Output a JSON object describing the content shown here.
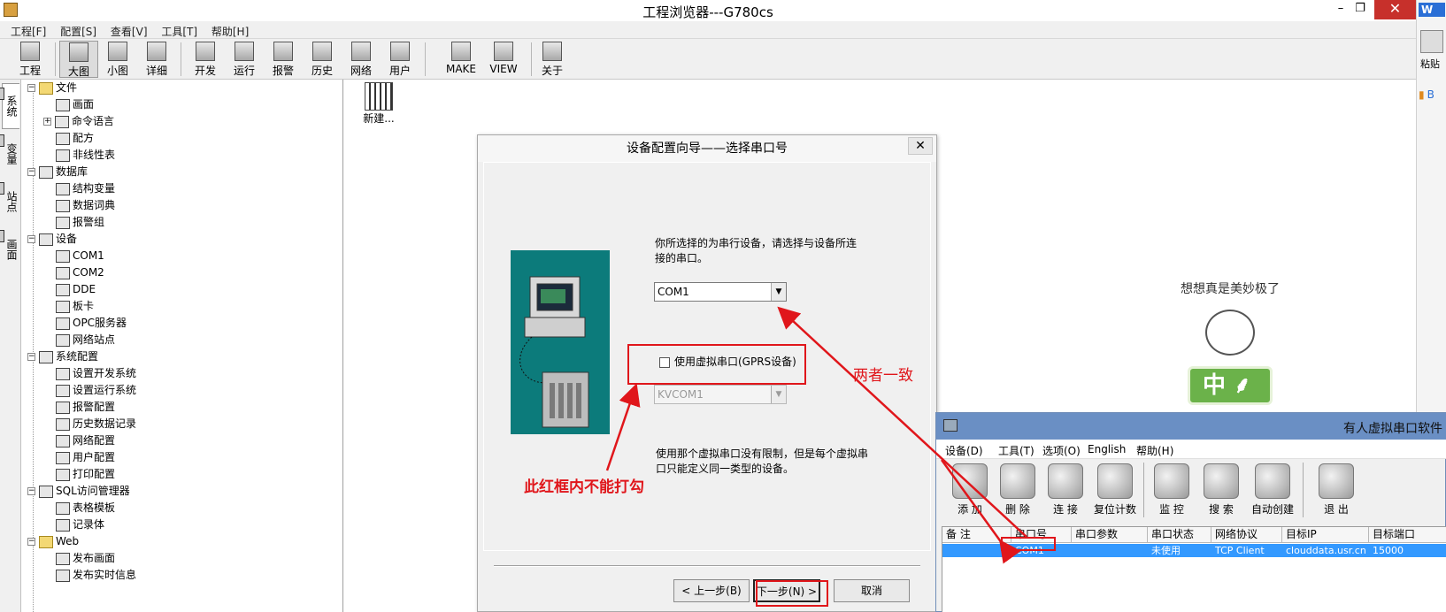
{
  "window": {
    "title": "工程浏览器---G780cs",
    "min": "–",
    "max": "❐",
    "close": "✕"
  },
  "menu": [
    "工程[F]",
    "配置[S]",
    "查看[V]",
    "工具[T]",
    "帮助[H]"
  ],
  "toolbar": [
    "工程",
    "大图",
    "小图",
    "详细",
    "开发",
    "运行",
    "报警",
    "历史",
    "网络",
    "用户",
    "MAKE",
    "VIEW",
    "关于"
  ],
  "side_tabs": [
    "系统",
    "变量",
    "站点",
    "画面"
  ],
  "tree": [
    "文件",
    "画面",
    "命令语言",
    "配方",
    "非线性表",
    "数据库",
    "结构变量",
    "数据词典",
    "报警组",
    "设备",
    "COM1",
    "COM2",
    "DDE",
    "板卡",
    "OPC服务器",
    "网络站点",
    "系统配置",
    "设置开发系统",
    "设置运行系统",
    "报警配置",
    "历史数据记录",
    "网络配置",
    "用户配置",
    "打印配置",
    "SQL访问管理器",
    "表格模板",
    "记录体",
    "Web",
    "发布画面",
    "发布实时信息"
  ],
  "canvas": {
    "new_item": "新建..."
  },
  "right_panel": {
    "logo": "W",
    "paste": "粘贴",
    "fold": "B"
  },
  "dialog": {
    "title": "设备配置向导——选择串口号",
    "close": "✕",
    "desc1": "你所选择的为串行设备，请选择与设备所连接的串口。",
    "port": "COM1",
    "checkbox_label": "使用虚拟串口(GPRS设备)",
    "checked": false,
    "virtual_port": "KVCOM1",
    "desc2": "使用那个虚拟串口没有限制，但是每个虚拟串口只能定义同一类型的设备。",
    "prev": "< 上一步(B)",
    "next": "下一步(N) >",
    "cancel": "取消"
  },
  "usr": {
    "title": "有人虚拟串口软件",
    "menu": [
      "设备(D)",
      "工具(T)",
      "选项(O)",
      "English",
      "帮助(H)"
    ],
    "buttons": [
      "添 加",
      "删 除",
      "连 接",
      "复位计数",
      "监 控",
      "搜 索",
      "自动创建",
      "退 出"
    ],
    "columns": [
      "备 注",
      "串口号",
      "串口参数",
      "串口状态",
      "网络协议",
      "目标IP",
      "目标端口"
    ],
    "row": {
      "note": "",
      "port": "COM1",
      "params": "",
      "status": "未使用",
      "protocol": "TCP Client",
      "ip": "clouddata.usr.cn",
      "dport": "15000"
    }
  },
  "sticker": {
    "text": "想想真是美妙极了",
    "sign": "中 ⸙ °₀"
  },
  "annotations": {
    "match": "两者一致",
    "no_check": "此红框内不能打勾"
  },
  "colors": {
    "annotation": "#e0161b",
    "usr_titlebar": "#6a8fc4",
    "selection": "#3399ff",
    "close": "#c7302b"
  }
}
